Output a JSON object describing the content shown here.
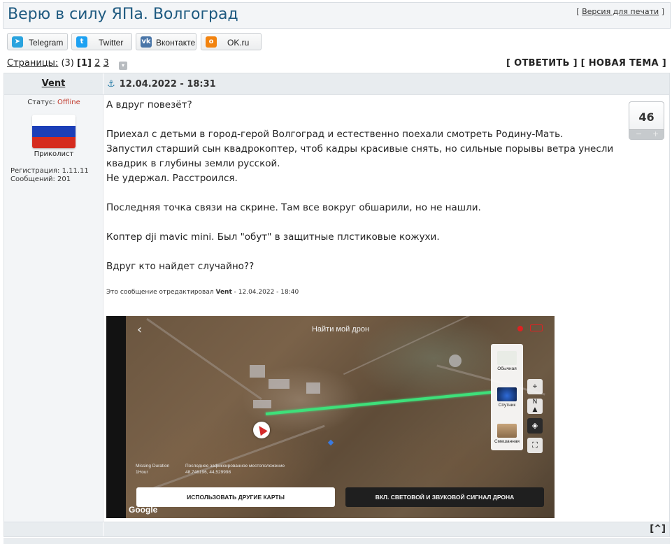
{
  "topic": {
    "title": "Верю в силу ЯПа. Волгоград",
    "print_version": "Версия для печати"
  },
  "share": [
    {
      "label": "Telegram",
      "icon": "telegram-icon",
      "color": "#2aa3de"
    },
    {
      "label": "Twitter",
      "icon": "twitter-icon",
      "color": "#1da1f2"
    },
    {
      "label": "Вконтакте",
      "icon": "vk-icon",
      "color": "#4a76a8"
    },
    {
      "label": "OK.ru",
      "icon": "ok-icon",
      "color": "#f2830f"
    }
  ],
  "pagination": {
    "label": "Страницы:",
    "count": "(3)",
    "current": "1",
    "pages": [
      "2",
      "3"
    ]
  },
  "actions": {
    "reply": "ОТВЕТИТЬ",
    "new_topic": "НОВАЯ ТЕМА"
  },
  "post": {
    "author": "Vent",
    "datetime": "12.04.2022 - 18:31",
    "status_label": "Статус:",
    "status_value": "Offline",
    "rank": "Приколист",
    "registration": "Регистрация: 1.11.11",
    "messages": "Сообщений: 201",
    "rating": "46",
    "lines": [
      "А вдруг повезёт?",
      "",
      "Приехал с детьми в город-герой Волгоград и естественно поехали смотреть Родину-Мать.",
      "Запустил старший сын квадрокоптер, чтоб кадры красивые снять, но сильные порывы ветра унесли",
      "квадрик в глубины земли русской.",
      "Не удержал. Расстроился.",
      "",
      "Последняя точка связи на скрине. Там все вокруг обшарили, но не нашли.",
      "",
      "Коптер dji mavic mini. Был \"обут\" в защитные плстиковые кожухи.",
      "",
      "Вдруг кто найдет случайно??"
    ],
    "edited_prefix": "Это сообщение отредактировал",
    "edited_by": "Vent",
    "edited_suffix": "- 12.04.2022 - 18:40"
  },
  "screenshot": {
    "title": "Найти мой дрон",
    "map_types": [
      "Обычная",
      "Спутник",
      "Смешанная"
    ],
    "missing_label": "Missing Duration",
    "missing_value": "1Hour",
    "last_location_label": "Последнее зафиксированное местоположение",
    "last_location_value": "48,746196, 44,529998",
    "btn_other_maps": "ИСПОЛЬЗОВАТЬ ДРУГИЕ КАРТЫ",
    "btn_signal": "ВКЛ. СВЕТОВОЙ И ЗВУКОВОЙ СИГНАЛ ДРОНА",
    "google": "Google",
    "north": "N"
  },
  "footer": {
    "to_top": "[^]"
  },
  "colors": {
    "title": "#1e5a80",
    "offline": "#c0392b",
    "header_bg": "#e8ecef",
    "sidebar_bg": "#f3f5f7",
    "path_green": "#3ee07a"
  }
}
